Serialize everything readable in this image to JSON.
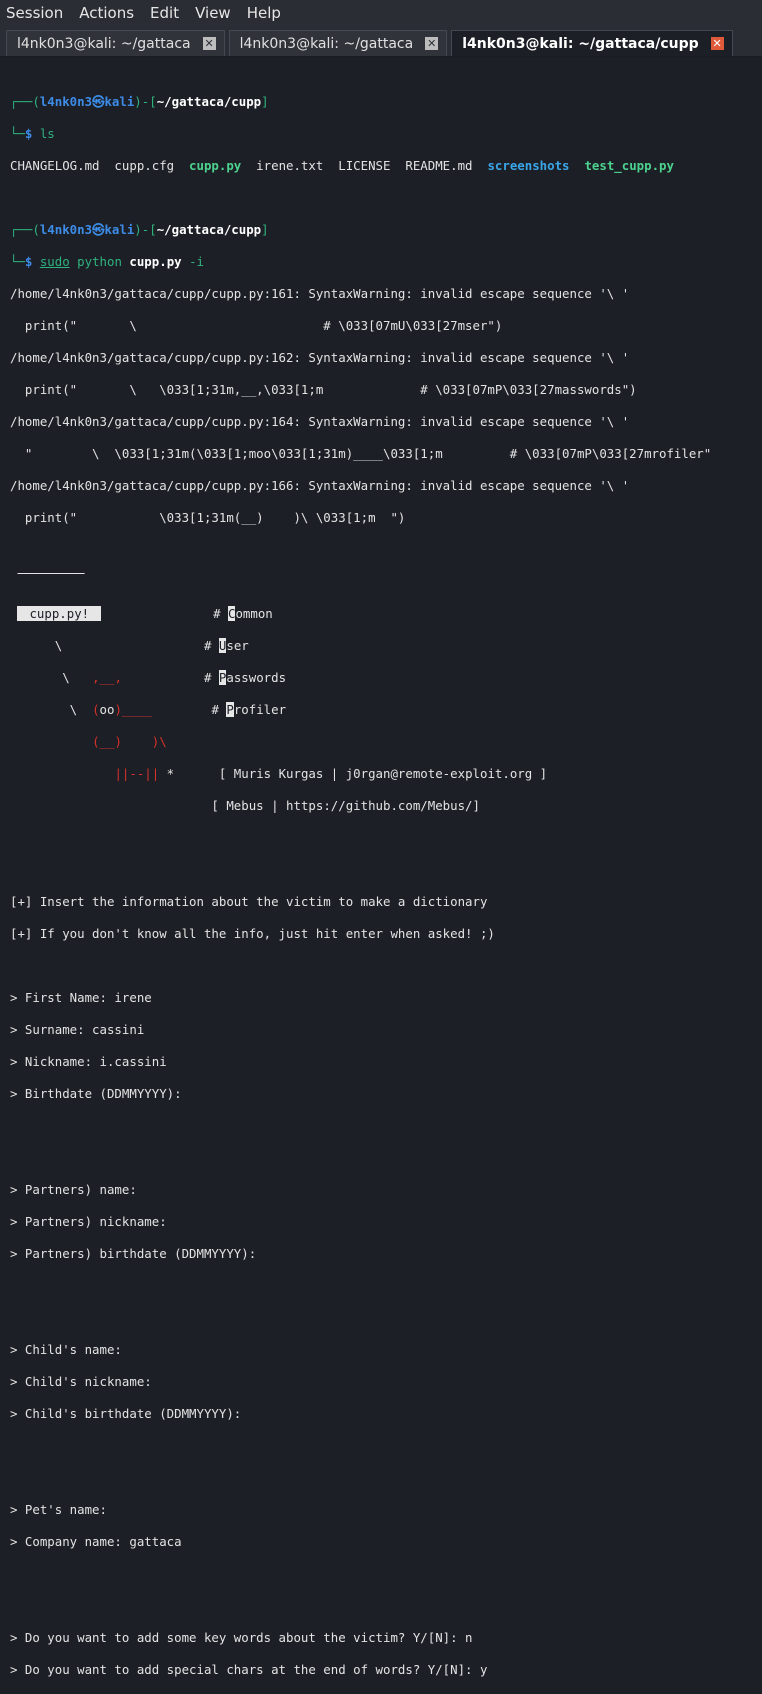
{
  "menu": [
    "Session",
    "Actions",
    "Edit",
    "View",
    "Help"
  ],
  "tabs": [
    {
      "label": "l4nk0n3@kali: ~/gattaca"
    },
    {
      "label": "l4nk0n3@kali: ~/gattaca"
    },
    {
      "label": "l4nk0n3@kali: ~/gattaca/cupp"
    }
  ],
  "prompt": {
    "user": "l4nk0n3",
    "host": "kali",
    "path": "~/gattaca/cupp"
  },
  "cmd1": "ls",
  "ls": {
    "plain1": "CHANGELOG.md  cupp.cfg  ",
    "exec1": "cupp.py",
    "plain2": "  irene.txt  LICENSE  README.md  ",
    "dir": "screenshots",
    "exec2": "test_cupp.py"
  },
  "cmd2": {
    "sudo": "sudo",
    "python": "python",
    "file": "cupp.py",
    "flag": "-i"
  },
  "warnings": [
    "/home/l4nk0n3/gattaca/cupp/cupp.py:161: SyntaxWarning: invalid escape sequence '\\ '",
    "  print(\"       \\                         # \\033[07mU\\033[27mser\")",
    "/home/l4nk0n3/gattaca/cupp/cupp.py:162: SyntaxWarning: invalid escape sequence '\\ '",
    "  print(\"       \\   \\033[1;31m,__,\\033[1;m             # \\033[07mP\\033[27masswords\")",
    "/home/l4nk0n3/gattaca/cupp/cupp.py:164: SyntaxWarning: invalid escape sequence '\\ '",
    "  \"        \\  \\033[1;31m(\\033[1;moo\\033[1;31m)____\\033[1;m         # \\033[07mP\\033[27mrofiler\"",
    "/home/l4nk0n3/gattaca/cupp/cupp.py:166: SyntaxWarning: invalid escape sequence '\\ '",
    "  print(\"           \\033[1;31m(__)    )\\ \\033[1;m  \")"
  ],
  "art": {
    "banner": "cupp.py!",
    "menu": [
      {
        "key": "C",
        "rest": "ommon"
      },
      {
        "key": "U",
        "rest": "ser"
      },
      {
        "key": "P",
        "rest": "asswords"
      },
      {
        "key": "P",
        "rest": "rofiler"
      }
    ],
    "credit1": "[ Muris Kurgas | j0rgan@remote-exploit.org ]",
    "credit2": "[ Mebus | https://github.com/Mebus/]"
  },
  "info1": "[+] Insert the information about the victim to make a dictionary",
  "info2": "[+] If you don't know all the info, just hit enter when asked! ;)",
  "form": [
    "> First Name: irene",
    "> Surname: cassini",
    "> Nickname: i.cassini",
    "> Birthdate (DDMMYYYY):",
    "",
    "",
    "> Partners) name:",
    "> Partners) nickname:",
    "> Partners) birthdate (DDMMYYYY):",
    "",
    "",
    "> Child's name:",
    "> Child's nickname:",
    "> Child's birthdate (DDMMYYYY):",
    "",
    "",
    "> Pet's name:",
    "> Company name: gattaca",
    "",
    "",
    "> Do you want to add some key words about the victim? Y/[N]: n",
    "> Do you want to add special chars at the end of words? Y/[N]: y"
  ],
  "colors": {
    "prompt": "#2fb37f",
    "host": "#3c8ce8",
    "exec": "#4cd28e",
    "dir": "#3aa6e8",
    "art": "#d8312b"
  }
}
